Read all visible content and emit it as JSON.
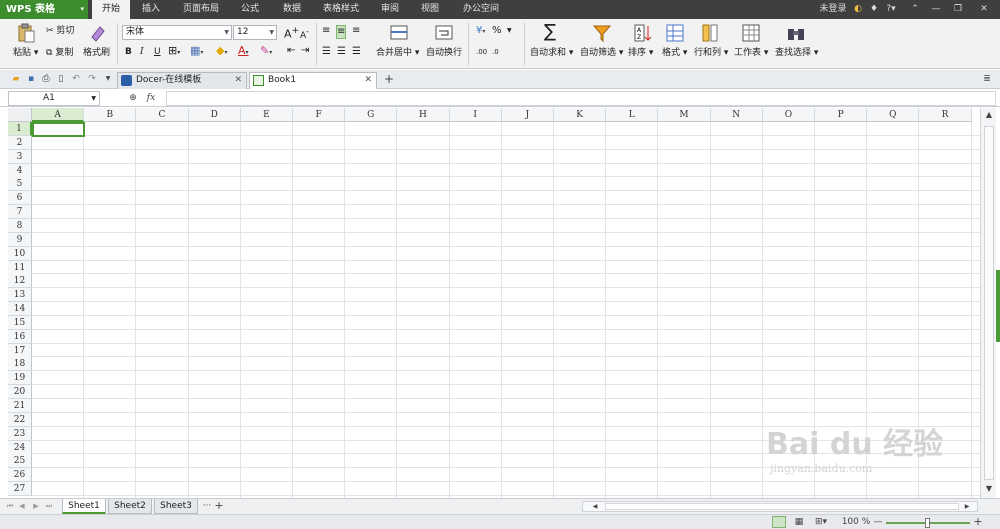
{
  "app": {
    "logo": "WPS 表格"
  },
  "menu": {
    "tabs": [
      "开始",
      "插入",
      "页面布局",
      "公式",
      "数据",
      "表格样式",
      "审阅",
      "视图",
      "办公空间"
    ],
    "active": "开始",
    "login": "未登录",
    "help": "?"
  },
  "ribbon": {
    "paste": "粘贴",
    "cut": "剪切",
    "copy": "复制",
    "format_painter": "格式刷",
    "font_name": "宋体",
    "font_size": "12",
    "bold": "B",
    "italic": "I",
    "underline": "U",
    "grow_font": "A",
    "shrink_font": "A",
    "merge_center": "合并居中",
    "wrap_text": "自动换行",
    "percent": "%",
    "dec_inc": ".00",
    "dec_dec": ".0",
    "autosum": "自动求和",
    "autofilter": "自动筛选",
    "sort": "排序",
    "format": "格式",
    "rows_cols": "行和列",
    "worksheet": "工作表",
    "find_select": "查找选择"
  },
  "doc_tabs": [
    {
      "label": "Docer-在线模板",
      "icon": "docer-icon"
    },
    {
      "label": "Book1",
      "icon": "spreadsheet-file-icon"
    }
  ],
  "active_doc": "Book1",
  "formula": {
    "name_box": "A1",
    "fx": "fx"
  },
  "grid": {
    "columns": [
      "A",
      "B",
      "C",
      "D",
      "E",
      "F",
      "G",
      "H",
      "I",
      "J",
      "K",
      "L",
      "M",
      "N",
      "O",
      "P",
      "Q",
      "R"
    ],
    "rows": [
      "1",
      "2",
      "3",
      "4",
      "5",
      "6",
      "7",
      "8",
      "9",
      "10",
      "11",
      "12",
      "13",
      "14",
      "15",
      "16",
      "17",
      "18",
      "19",
      "20",
      "21",
      "22",
      "23",
      "24",
      "25",
      "26",
      "27"
    ],
    "selected_cell": "A1"
  },
  "sheets": {
    "tabs": [
      "Sheet1",
      "Sheet2",
      "Sheet3"
    ],
    "active": "Sheet1",
    "more": "···",
    "add": "+"
  },
  "status": {
    "zoom": "100 %",
    "zoom_out": "—",
    "zoom_in": "+",
    "zoom_level": 0.5
  },
  "watermark": {
    "brand": "Bai du 经验",
    "url": "jingyan.baidu.com"
  },
  "colors": {
    "accent": "#3d8c2e",
    "menubar": "#3f3f3f",
    "selection": "#4c9a36"
  }
}
